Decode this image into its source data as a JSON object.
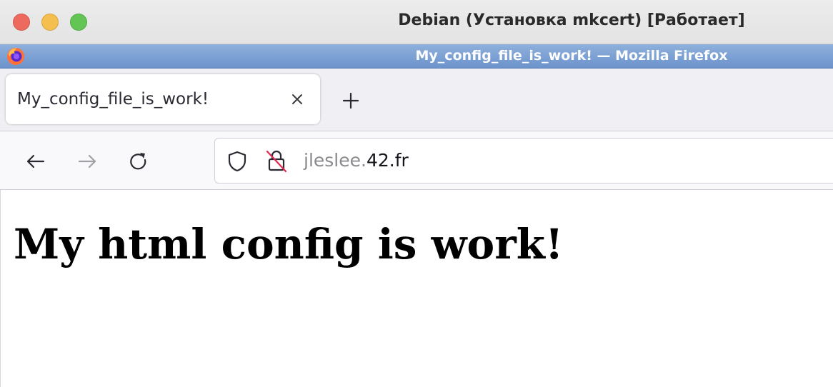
{
  "host_window": {
    "title": "Debian (Установка mkcert) [Работает]",
    "buttons": [
      "close",
      "minimize",
      "maximize"
    ]
  },
  "browser_window": {
    "title": "My_config_file_is_work! — Mozilla Firefox",
    "app_icon": "firefox-logo-icon"
  },
  "tabs": [
    {
      "label": "My_config_file_is_work!",
      "close_icon": "close-icon",
      "active": true
    }
  ],
  "new_tab_icon": "plus-icon",
  "nav": {
    "back_icon": "arrow-left-icon",
    "forward_icon": "arrow-right-icon",
    "reload_icon": "reload-icon"
  },
  "urlbar": {
    "security_icons": [
      "shield-icon",
      "insecure-lock-icon"
    ],
    "url_subdomain": "jleslee.",
    "url_domain": "42.fr"
  },
  "page": {
    "heading": "My html config is work!"
  },
  "colors": {
    "ff_titlebar": "#7ea1d4",
    "close_light": "#ed6a5e",
    "minimize_light": "#f5bf4f",
    "maximize_light": "#62c554",
    "insecure_slash": "#e22850"
  }
}
